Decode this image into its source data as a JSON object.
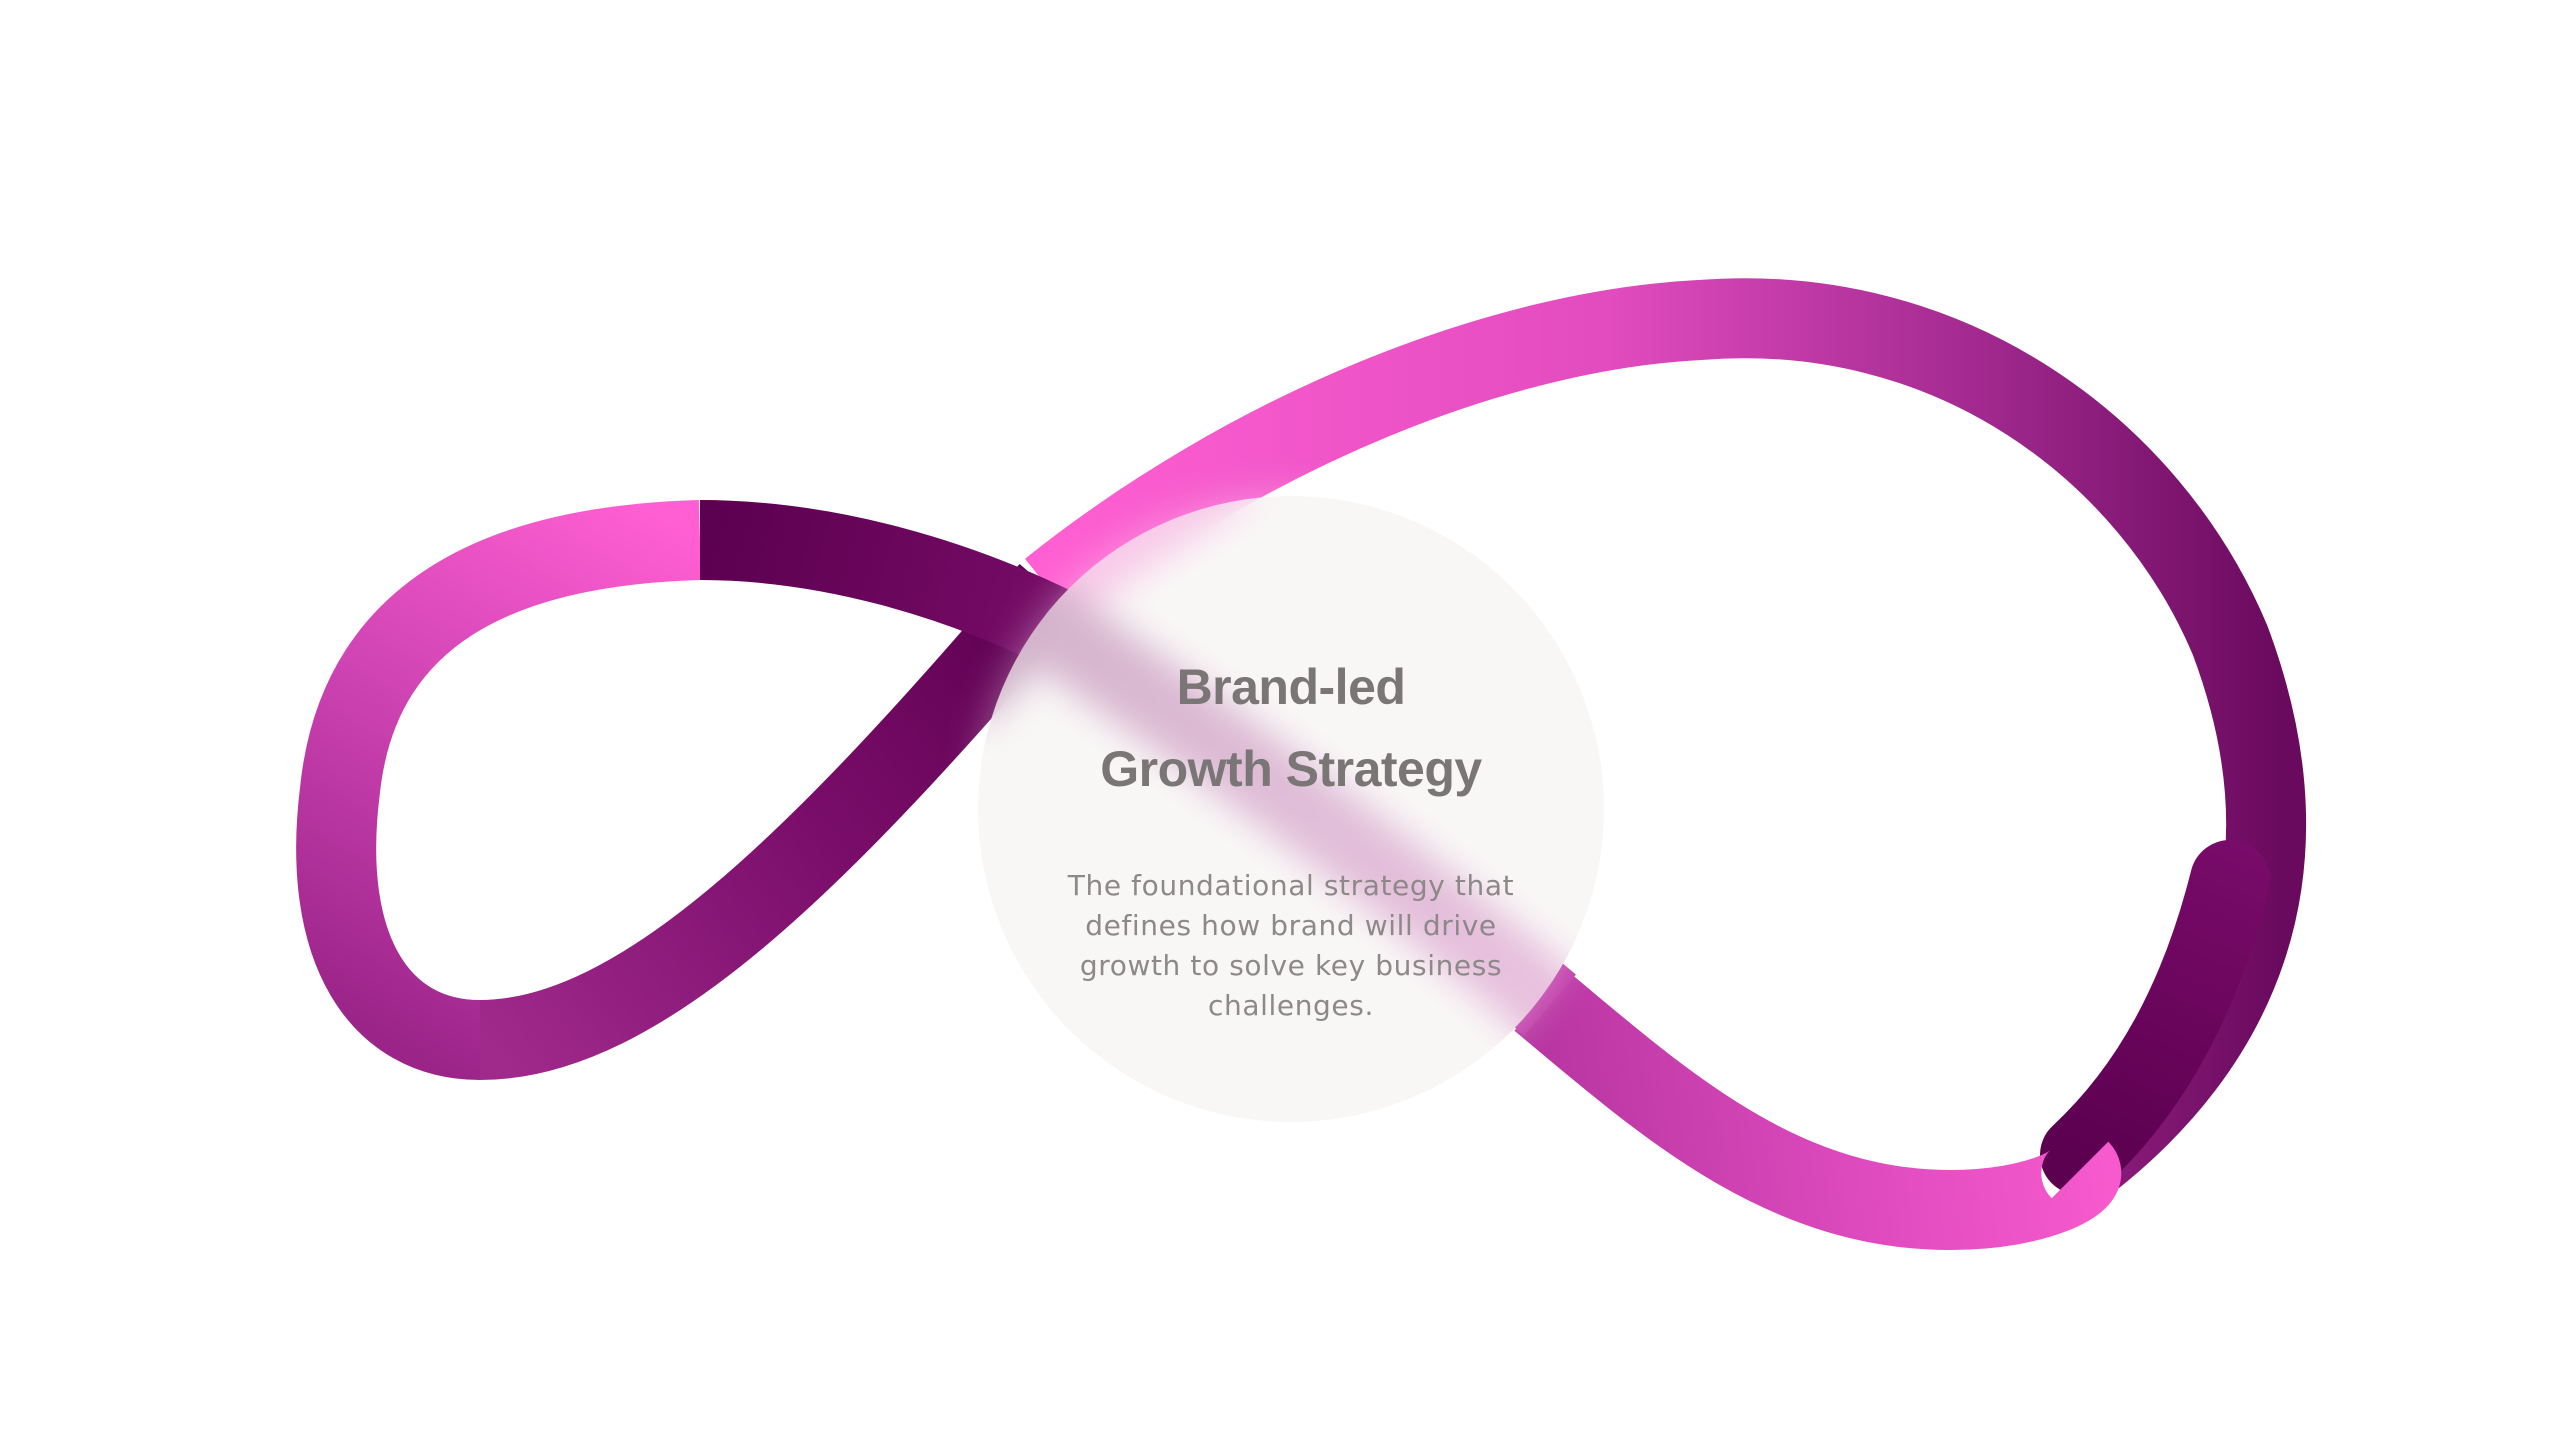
{
  "diagram": {
    "title_line_1": "Brand-led",
    "title_line_2": "Growth Strategy",
    "description": "The foundational strategy that defines how brand will drive growth to solve key business challenges."
  },
  "colors": {
    "background": "#ffffff",
    "loop_light": "#ff5fd2",
    "loop_mid": "#a32a90",
    "loop_dark": "#5c0050",
    "lens_fill": "#f6f4f2",
    "title_text": "#7a7676",
    "body_text": "#8d8989"
  }
}
